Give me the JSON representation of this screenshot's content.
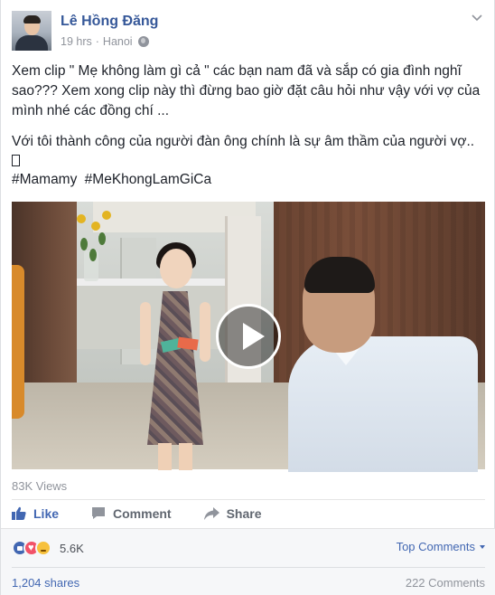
{
  "post": {
    "author": "Lê Hồng Đăng",
    "time": "19 hrs",
    "separator": "·",
    "location": "Hanoi",
    "paragraph_1": "Xem clip \" Mẹ không làm gì cả \" các bạn nam đã và sắp có gia đình nghĩ sao??? Xem xong clip này thì đừng bao giờ đặt câu hỏi như vậy với vợ của mình nhé các đồng chí ...",
    "paragraph_2": "Với tôi thành công của người đàn ông chính là sự âm thầm của người vợ..",
    "hashtags": [
      "#Mamamy",
      "#MeKhongLamGiCa"
    ],
    "views": "83K Views"
  },
  "actions": {
    "like_label": "Like",
    "comment_label": "Comment",
    "share_label": "Share"
  },
  "footer": {
    "reaction_count": "5.6K",
    "top_comments_label": "Top Comments",
    "shares": "1,204 shares",
    "comments": "222 Comments"
  },
  "colors": {
    "link_blue": "#365899",
    "accent_blue": "#4267b2",
    "meta_grey": "#90949c"
  },
  "icons": [
    "globe-icon",
    "chevron-down-icon",
    "play-icon",
    "like-icon",
    "comment-icon",
    "share-icon",
    "reaction-like-icon",
    "reaction-love-icon",
    "reaction-sad-icon"
  ]
}
